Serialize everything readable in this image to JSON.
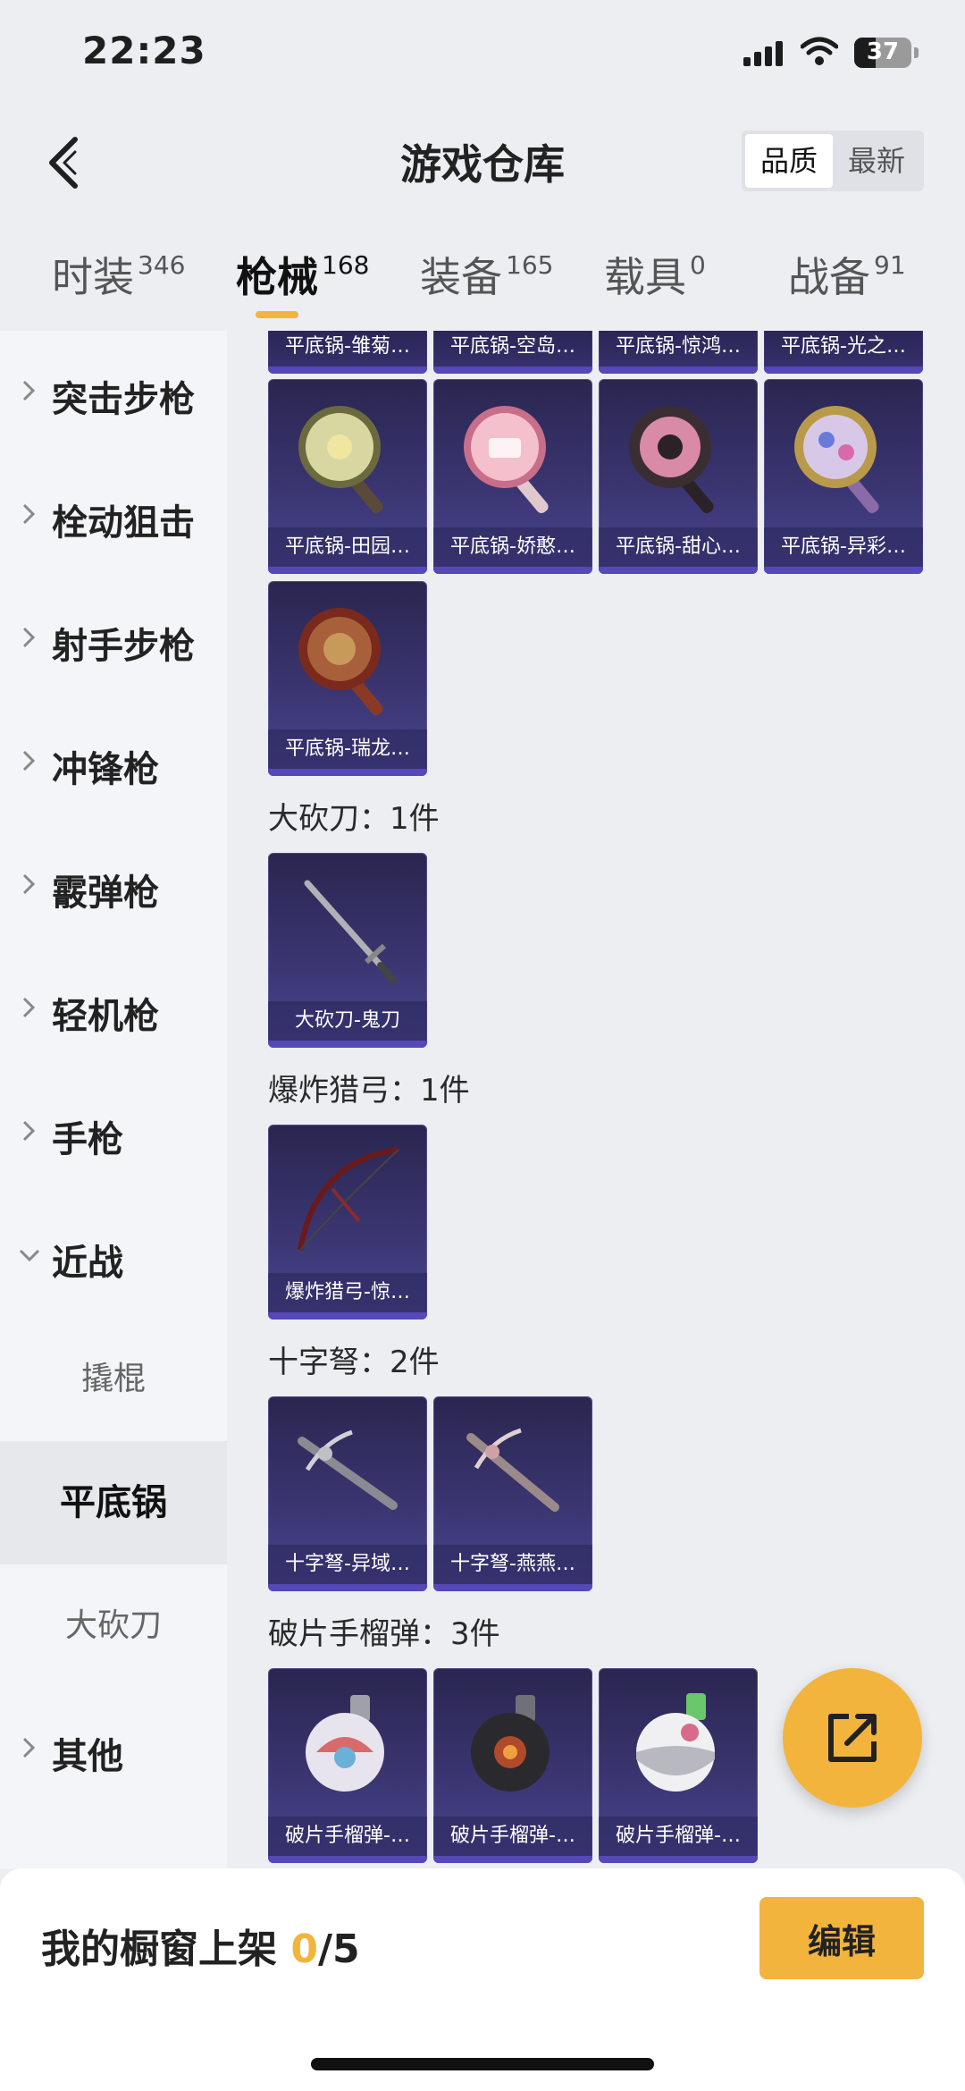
{
  "status_bar": {
    "time": "22:23",
    "battery": "37",
    "battery_level": 0.37
  },
  "header": {
    "title": "游戏仓库",
    "sort_options": [
      "品质",
      "最新"
    ],
    "sort_selected": "品质"
  },
  "tabs": [
    {
      "label": "时装",
      "count": "346"
    },
    {
      "label": "枪械",
      "count": "168",
      "active": true
    },
    {
      "label": "装备",
      "count": "165"
    },
    {
      "label": "载具",
      "count": "0"
    },
    {
      "label": "战备",
      "count": "91"
    }
  ],
  "sidebar": {
    "items": [
      {
        "label": "突击步枪"
      },
      {
        "label": "栓动狙击"
      },
      {
        "label": "射手步枪"
      },
      {
        "label": "冲锋枪"
      },
      {
        "label": "霰弹枪"
      },
      {
        "label": "轻机枪"
      },
      {
        "label": "手枪"
      },
      {
        "label": "近战",
        "expanded": true
      },
      {
        "label": "其他"
      }
    ],
    "sub_items": [
      {
        "label": "撬棍"
      },
      {
        "label": "平底锅",
        "active": true
      },
      {
        "label": "大砍刀"
      }
    ]
  },
  "content": {
    "top_partial_row": [
      "平底锅-雏菊…",
      "平底锅-空岛…",
      "平底锅-惊鸿…",
      "平底锅-光之…"
    ],
    "pan_row_1": [
      "平底锅-田园…",
      "平底锅-娇憨…",
      "平底锅-甜心…",
      "平底锅-异彩…"
    ],
    "pan_row_2": [
      "平底锅-瑞龙…"
    ],
    "sections": [
      {
        "title": "大砍刀：1件",
        "items": [
          "大砍刀-鬼刀"
        ]
      },
      {
        "title": "爆炸猎弓：1件",
        "items": [
          "爆炸猎弓-惊…"
        ]
      },
      {
        "title": "十字弩：2件",
        "items": [
          "十字弩-异域…",
          "十字弩-燕燕…"
        ]
      },
      {
        "title": "破片手榴弹：3件",
        "items": [
          "破片手榴弹-…",
          "破片手榴弹-…",
          "破片手榴弹-…"
        ]
      }
    ]
  },
  "bottom": {
    "shelf_label": "我的橱窗上架",
    "shelf_used": "0",
    "shelf_total": "/5",
    "edit_label": "编辑"
  },
  "colors": {
    "accent": "#f2b43c",
    "card_top": "#2a2650",
    "card_bottom": "#4a4592"
  }
}
